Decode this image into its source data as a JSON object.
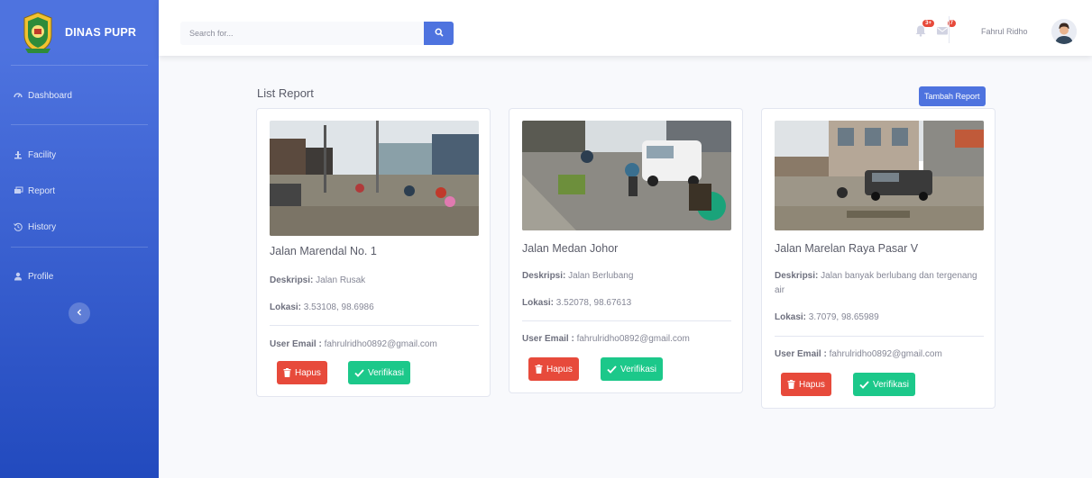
{
  "brand": {
    "name": "DINAS PUPR"
  },
  "sidebar": {
    "items": [
      {
        "label": "Dashboard",
        "icon": "dashboard-icon"
      },
      {
        "label": "Facility",
        "icon": "facility-icon"
      },
      {
        "label": "Report",
        "icon": "report-icon"
      },
      {
        "label": "History",
        "icon": "history-icon"
      },
      {
        "label": "Profile",
        "icon": "profile-icon"
      }
    ],
    "toggle_icon": "chevron-left-icon"
  },
  "topbar": {
    "search_placeholder": "Search for...",
    "alerts_badge": "3+",
    "messages_badge": "7",
    "username": "Fahrul Ridho"
  },
  "main": {
    "page_title": "List Report",
    "add_button": "Tambah Report"
  },
  "labels": {
    "description": "Deskripsi:",
    "location": "Lokasi:",
    "user_email": "User Email :",
    "delete": "Hapus",
    "verify": "Verifikasi"
  },
  "reports": [
    {
      "title": "Jalan Marendal No. 1",
      "description": "Jalan Rusak",
      "location": "3.53108, 98.6986",
      "email": "fahrulridho0892@gmail.com"
    },
    {
      "title": "Jalan Medan Johor",
      "description": "Jalan Berlubang",
      "location": "3.52078, 98.67613",
      "email": "fahrulridho0892@gmail.com"
    },
    {
      "title": "Jalan Marelan Raya Pasar V",
      "description": "Jalan banyak berlubang dan tergenang air",
      "location": "3.7079, 98.65989",
      "email": "fahrulridho0892@gmail.com"
    }
  ],
  "colors": {
    "primary": "#4e73df",
    "danger": "#e74a3b",
    "success": "#1cc88a"
  }
}
